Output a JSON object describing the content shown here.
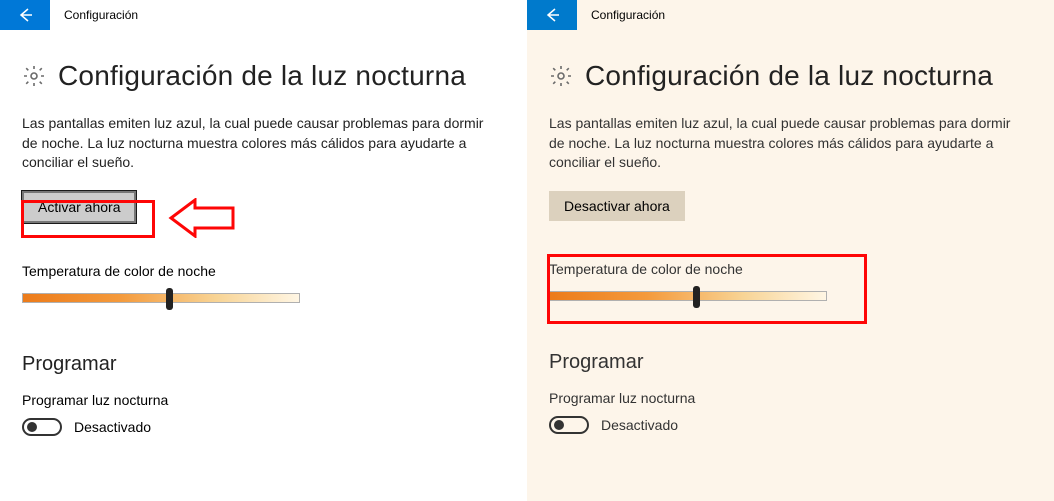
{
  "left": {
    "app_title": "Configuración",
    "page_title": "Configuración de la luz nocturna",
    "description": "Las pantallas emiten luz azul, la cual puede causar problemas para dormir de noche. La luz nocturna muestra colores más cálidos para ayudarte a conciliar el sueño.",
    "action_button": "Activar ahora",
    "temp_label": "Temperatura de color de noche",
    "slider_position_pct": 53,
    "schedule_section": "Programar",
    "schedule_label": "Programar luz nocturna",
    "toggle_state_label": "Desactivado"
  },
  "right": {
    "app_title": "Configuración",
    "page_title": "Configuración de la luz nocturna",
    "description": "Las pantallas emiten luz azul, la cual puede causar problemas para dormir de noche. La luz nocturna muestra colores más cálidos para ayudarte a conciliar el sueño.",
    "action_button": "Desactivar ahora",
    "temp_label": "Temperatura de color de noche",
    "slider_position_pct": 53,
    "schedule_section": "Programar",
    "schedule_label": "Programar luz nocturna",
    "toggle_state_label": "Desactivado"
  },
  "annotation_color": "#fe0606"
}
